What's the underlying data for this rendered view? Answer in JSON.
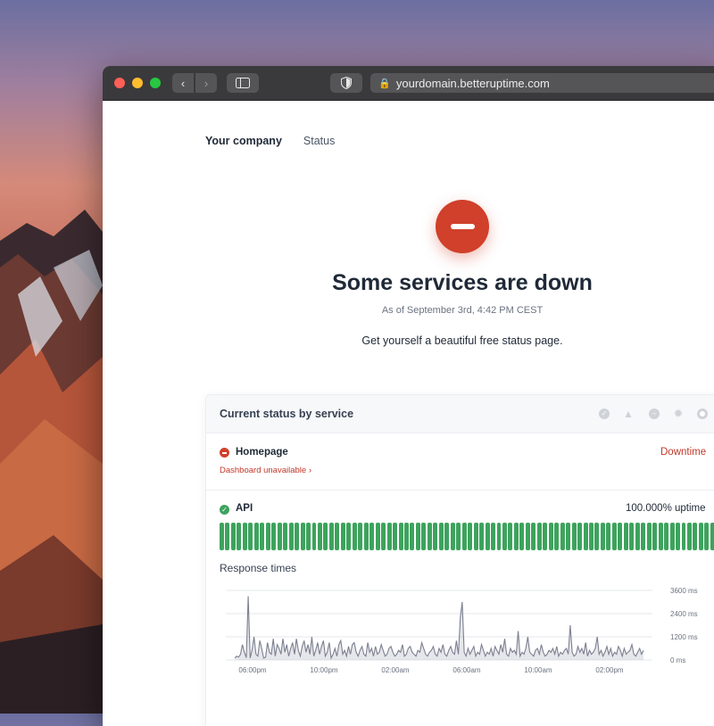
{
  "browser": {
    "url": "yourdomain.betteruptime.com"
  },
  "nav": {
    "brand": "Your company",
    "status_link": "Status"
  },
  "hero": {
    "headline": "Some services are down",
    "as_of": "As of September 3rd, 4:42 PM CEST",
    "tagline": "Get yourself a beautiful free status page."
  },
  "card": {
    "title": "Current status by service",
    "legend_icons": [
      "check-circle-icon",
      "warning-icon",
      "minus-circle-icon",
      "gear-icon",
      "circle-icon"
    ]
  },
  "services": [
    {
      "name": "Homepage",
      "sub": "Dashboard unavailable ›",
      "status": "Downtime",
      "color": "#d0402a"
    },
    {
      "name": "API",
      "uptime": "100.000% uptime",
      "color": "#3da35d",
      "uptime_bar_count": 90
    }
  ],
  "response_times": {
    "title": "Response times"
  },
  "chart_data": {
    "type": "line",
    "title": "Response times",
    "xlabel": "",
    "ylabel": "",
    "x_ticks": [
      "06:00pm",
      "10:00pm",
      "02:00am",
      "06:00am",
      "10:00am",
      "02:00pm"
    ],
    "y_ticks": [
      "3600 ms",
      "2400 ms",
      "1200 ms",
      "0 ms"
    ],
    "ylim": [
      0,
      3600
    ],
    "y_values": [
      100,
      200,
      150,
      300,
      800,
      400,
      120,
      3300,
      100,
      500,
      1200,
      300,
      200,
      1000,
      600,
      100,
      150,
      900,
      400,
      300,
      1100,
      200,
      800,
      600,
      300,
      1100,
      400,
      800,
      200,
      600,
      900,
      300,
      1100,
      500,
      200,
      700,
      1000,
      400,
      800,
      300,
      1200,
      200,
      500,
      900,
      300,
      700,
      1000,
      200,
      400,
      900,
      100,
      300,
      600,
      200,
      800,
      1000,
      300,
      500,
      200,
      700,
      300,
      800,
      900,
      400,
      200,
      500,
      700,
      300,
      200,
      900,
      400,
      600,
      200,
      700,
      300,
      400,
      800,
      500,
      200,
      300,
      600,
      700,
      400,
      200,
      300,
      500,
      400,
      800,
      200,
      300,
      600,
      700,
      400,
      300,
      200,
      500,
      400,
      900,
      600,
      300,
      200,
      400,
      500,
      700,
      300,
      200,
      600,
      400,
      800,
      300,
      200,
      500,
      700,
      400,
      300,
      1000,
      300,
      2200,
      3000,
      400,
      200,
      600,
      300,
      500,
      700,
      200,
      400,
      300,
      800,
      500,
      200,
      400,
      300,
      600,
      200,
      700,
      500,
      300,
      800,
      400,
      1100,
      300,
      200,
      600,
      400,
      500,
      300,
      1500,
      200,
      400,
      300,
      600,
      1200,
      400,
      300,
      200,
      500,
      600,
      300,
      800,
      400,
      200,
      300,
      500,
      400,
      600,
      300,
      700,
      200,
      400,
      300,
      500,
      600,
      300,
      1800,
      400,
      200,
      300,
      700,
      400,
      600,
      300,
      900,
      200,
      500,
      300,
      400,
      600,
      1200,
      300,
      500,
      200,
      400,
      700,
      300,
      600,
      200,
      400,
      300,
      700,
      500,
      200,
      600,
      300,
      400,
      500,
      800,
      300,
      200,
      400,
      600,
      300,
      500
    ]
  }
}
